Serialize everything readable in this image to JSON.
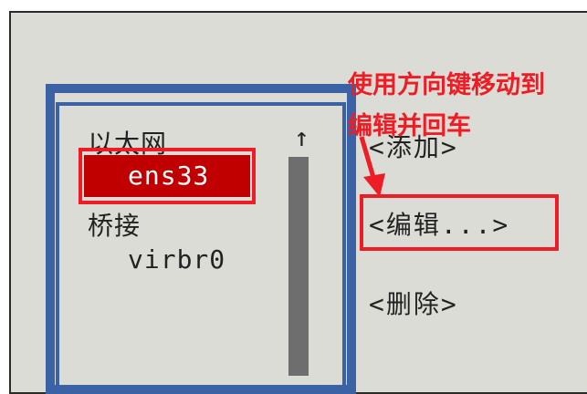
{
  "annotation": {
    "line1": "使用方向键移动到",
    "line2": "编辑并回车",
    "color": "#ee1c24"
  },
  "list": {
    "category_ethernet": "以太网",
    "item_ens33": "ens33",
    "category_bridge": "桥接",
    "item_virbr0": "virbr0",
    "scroll_up_glyph": "↑"
  },
  "buttons": {
    "add": "<添加>",
    "edit": "<编辑...>",
    "delete": "<删除>"
  },
  "colors": {
    "frame": "#3c62a6",
    "selection": "#c00000",
    "background": "#dcdcd6",
    "scrollbar": "#6e6e6e"
  }
}
